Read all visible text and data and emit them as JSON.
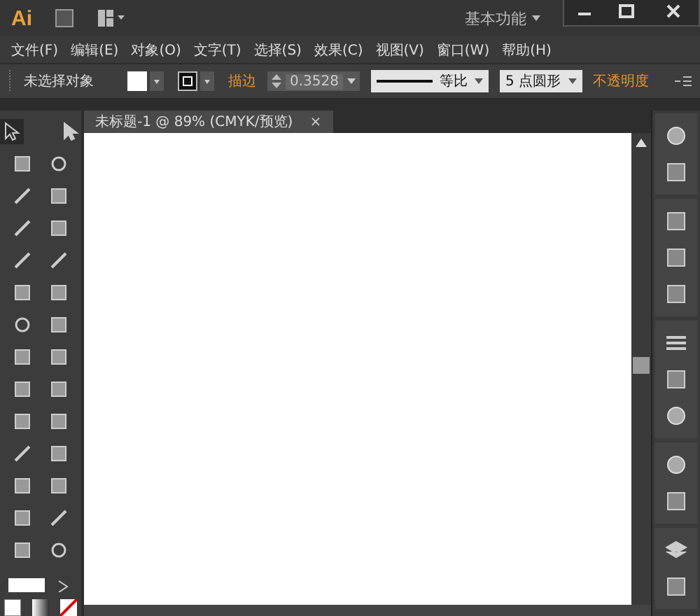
{
  "app": {
    "logo": "Ai",
    "workspace": "基本功能"
  },
  "menu": [
    "文件(F)",
    "编辑(E)",
    "对象(O)",
    "文字(T)",
    "选择(S)",
    "效果(C)",
    "视图(V)",
    "窗口(W)",
    "帮助(H)"
  ],
  "control_bar": {
    "selection": "未选择对象",
    "stroke_label": "描边",
    "stroke_weight": "0.3528",
    "stroke_profile": "等比",
    "brush": "5 点圆形",
    "opacity_label": "不透明度"
  },
  "document_tab": {
    "title": "未标题-1 @ 89% (CMYK/预览)",
    "close": "×"
  }
}
